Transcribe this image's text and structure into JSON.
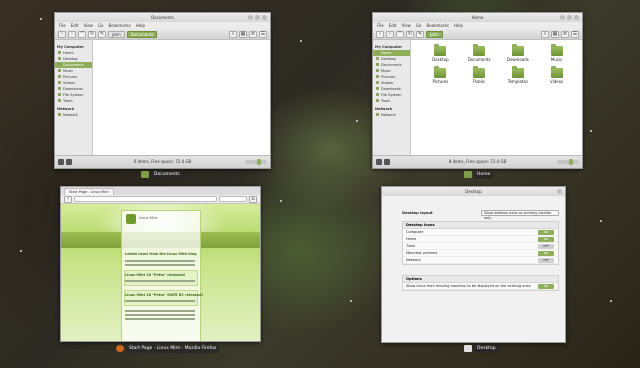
{
  "documents_window": {
    "title": "Documents",
    "menu": [
      "File",
      "Edit",
      "View",
      "Go",
      "Bookmarks",
      "Help"
    ],
    "breadcrumbs": [
      "john",
      "Documents"
    ],
    "sidebar": {
      "computer_header": "My Computer",
      "computer_items": [
        "Home",
        "Desktop",
        "Documents",
        "Music",
        "Pictures",
        "Videos",
        "Downloads",
        "File System",
        "Trash"
      ],
      "active_item": "Documents",
      "network_header": "Network",
      "network_items": [
        "Network"
      ]
    },
    "status": "0 items, Free space: 72.4 GB",
    "caption": "Documents"
  },
  "home_window": {
    "title": "Home",
    "menu": [
      "File",
      "Edit",
      "View",
      "Go",
      "Bookmarks",
      "Help"
    ],
    "breadcrumbs": [
      "john"
    ],
    "sidebar": {
      "computer_header": "My Computer",
      "computer_items": [
        "Home",
        "Desktop",
        "Documents",
        "Music",
        "Pictures",
        "Videos",
        "Downloads",
        "File System",
        "Trash"
      ],
      "active_item": "Home",
      "network_header": "Network",
      "network_items": [
        "Network"
      ]
    },
    "folders": [
      "Desktop",
      "Documents",
      "Downloads",
      "Music",
      "Pictures",
      "Public",
      "Templates",
      "Videos"
    ],
    "status": "8 items, Free space: 72.4 GB",
    "caption": "Home"
  },
  "firefox_window": {
    "tab": "Start Page - Linux Mint",
    "logo_text": "Linux Mint",
    "headings": [
      "Latest news from the Linux Mint blog",
      "Linux Mint 16 \"Petra\" released!",
      "Linux Mint 16 \"Petra\" MATE RC released!"
    ],
    "caption": "Start Page - Linux Mint - Mozilla Firefox"
  },
  "desktop_window": {
    "title": "Desktop",
    "layout_label": "Desktop layout",
    "layout_value": "Show desktop icons on primary monitor only",
    "icons_header": "Desktop Icons",
    "icons": [
      {
        "label": "Computer",
        "state": "ON"
      },
      {
        "label": "Home",
        "state": "ON"
      },
      {
        "label": "Trash",
        "state": "OFF"
      },
      {
        "label": "Mounted volumes",
        "state": "ON"
      },
      {
        "label": "Network",
        "state": "OFF"
      }
    ],
    "options_header": "Options",
    "options": [
      {
        "label": "Allow icons from missing monitors to be displayed on the existing ones",
        "state": "ON"
      }
    ],
    "caption": "Desktop"
  },
  "colors": {
    "accent": "#8fae5a",
    "accent_dark": "#6f8e3c"
  }
}
